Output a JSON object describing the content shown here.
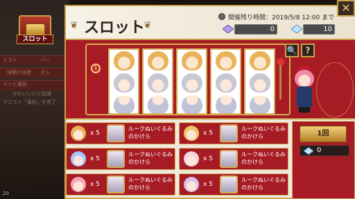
{
  "left_panel": {
    "event_label": "スロット",
    "ghost_lines": [
      "エスト",
      "パー",
      "タン",
      "帰郷の道標",
      "マンと邂逅",
      "かわいいけど危険",
      "クエスト「貴船」を完了"
    ],
    "bottom_counter": "20"
  },
  "header": {
    "title": "スロット",
    "remaining_label": "開催残り時間：",
    "remaining_value": "2019/5/8 12:00 まで",
    "purple_gem_count": "0",
    "blue_gem_count": "10",
    "close_symbol": "✕"
  },
  "machine": {
    "badge_text": "1",
    "search_symbol": "🔍",
    "help_symbol": "?",
    "reels": [
      [
        "gold",
        "silver",
        "partial"
      ],
      [
        "gold",
        "silver",
        "partial"
      ],
      [
        "gold",
        "silver",
        "partial"
      ],
      [
        "gold",
        "silver",
        "partial"
      ],
      [
        "gold",
        "silver",
        "partial"
      ]
    ]
  },
  "rewards": [
    {
      "icon_color": "#e9b254",
      "multiplier": "x 5",
      "prize": "ルークぬいぐるみのかけら"
    },
    {
      "icon_color": "#f0c66a",
      "multiplier": "x 5",
      "prize": "ルークぬいぐるみのかけら"
    },
    {
      "icon_color": "#a8c6ff",
      "multiplier": "x 5",
      "prize": "ルークぬいぐるみのかけら"
    },
    {
      "icon_color": "#f0d6e0",
      "multiplier": "x 5",
      "prize": "ルークぬいぐるみのかけら"
    },
    {
      "icon_color": "#f6a4b8",
      "multiplier": "x 5",
      "prize": "ルークぬいぐるみのかけら"
    },
    {
      "icon_color": "#d8c0f0",
      "multiplier": "x 5",
      "prize": "ルークぬいぐるみのかけら"
    }
  ],
  "spin": {
    "button_label": "1回",
    "cost": "0"
  },
  "colors": {
    "panel_red": "#a71c24",
    "gold_trim": "#c9a24a",
    "cream": "#efe9de"
  }
}
